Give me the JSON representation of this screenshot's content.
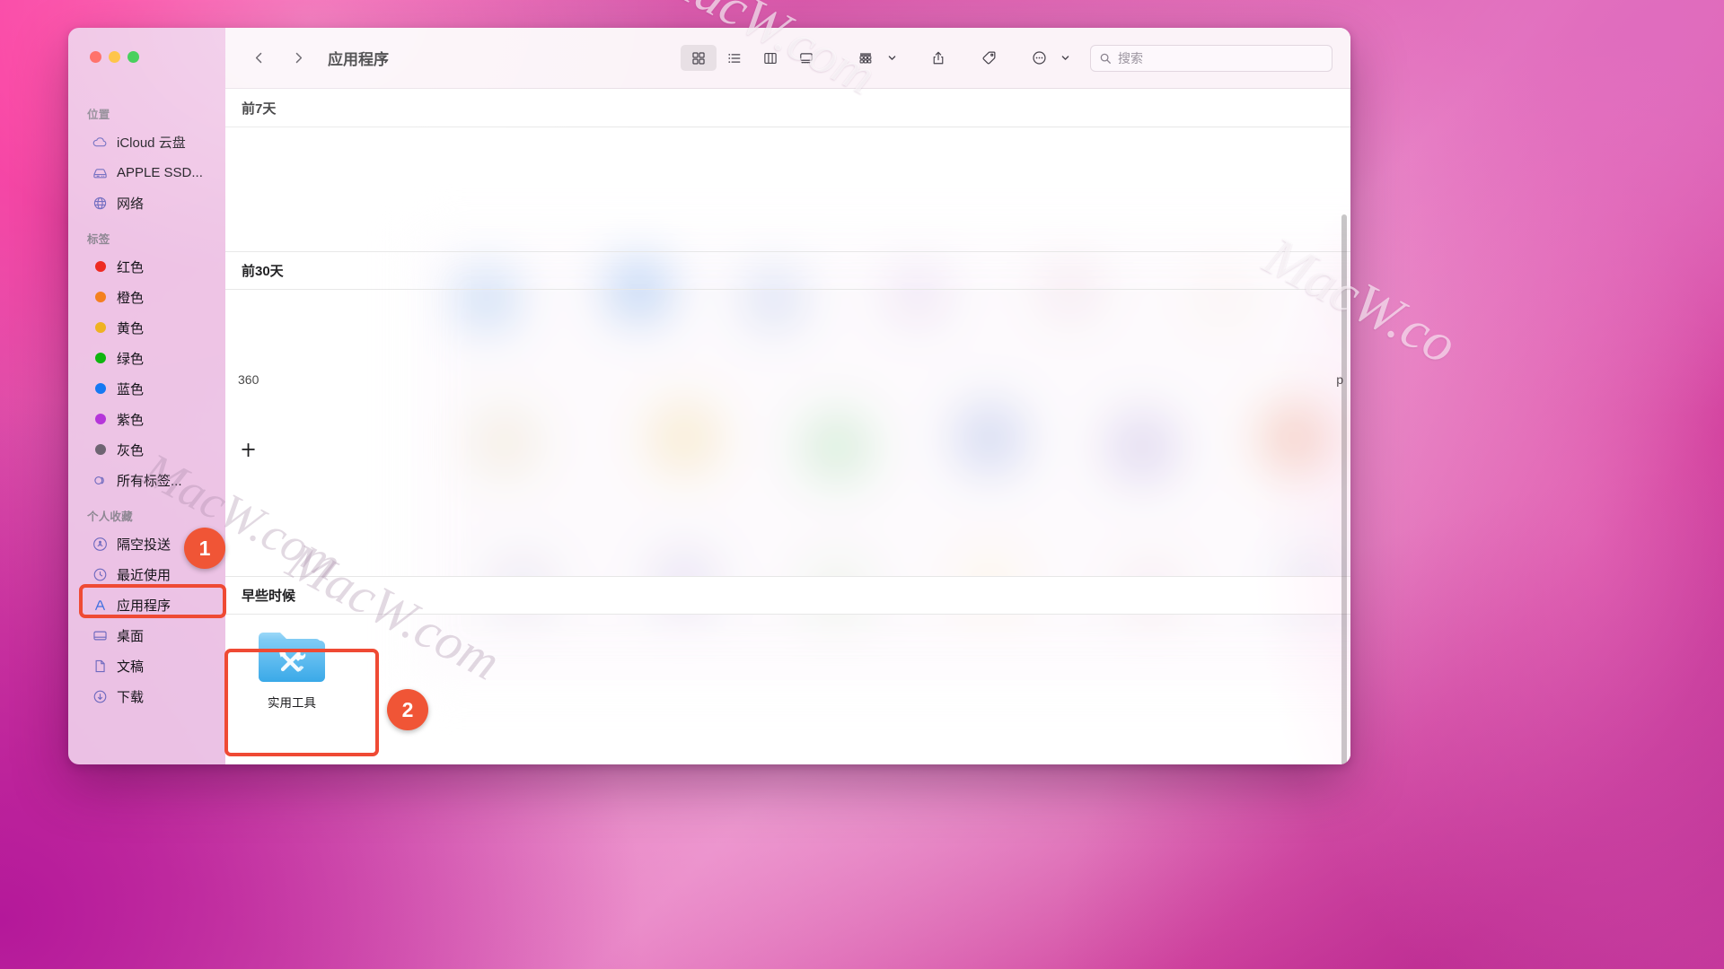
{
  "window": {
    "title": "应用程序",
    "traffic_lights": {
      "close": "#ff5f57",
      "minimize": "#febc2e",
      "maximize": "#28c840"
    }
  },
  "toolbar": {
    "back_label": "‹",
    "forward_label": "›",
    "view_buttons": [
      {
        "name": "icon-view",
        "label": "图标显示",
        "active": true
      },
      {
        "name": "list-view",
        "label": "列表显示",
        "active": false
      },
      {
        "name": "column-view",
        "label": "分栏显示",
        "active": false
      },
      {
        "name": "gallery-view",
        "label": "画廊显示",
        "active": false
      }
    ],
    "group_label": "排序方式",
    "share_label": "共享",
    "tag_label": "标签",
    "more_label": "更多"
  },
  "search": {
    "placeholder": "搜索",
    "value": ""
  },
  "sidebar": {
    "groups": [
      {
        "title": "位置",
        "items": [
          {
            "icon": "icloud-icon",
            "label": "iCloud 云盘"
          },
          {
            "icon": "harddisk-icon",
            "label": "APPLE SSD..."
          },
          {
            "icon": "globe-icon",
            "label": "网络"
          }
        ]
      },
      {
        "title": "标签",
        "items": [
          {
            "icon": "tag-dot-icon",
            "label": "红色",
            "color": "#ee2a22"
          },
          {
            "icon": "tag-dot-icon",
            "label": "橙色",
            "color": "#f4801f"
          },
          {
            "icon": "tag-dot-icon",
            "label": "黄色",
            "color": "#efb222"
          },
          {
            "icon": "tag-dot-icon",
            "label": "绿色",
            "color": "#0fb50f"
          },
          {
            "icon": "tag-dot-icon",
            "label": "蓝色",
            "color": "#1678f2"
          },
          {
            "icon": "tag-dot-icon",
            "label": "紫色",
            "color": "#b536d9"
          },
          {
            "icon": "tag-dot-icon",
            "label": "灰色",
            "color": "#6e6472"
          },
          {
            "icon": "all-tags-icon",
            "label": "所有标签..."
          }
        ]
      },
      {
        "title": "个人收藏",
        "items": [
          {
            "icon": "airdrop-icon",
            "label": "隔空投送"
          },
          {
            "icon": "clock-icon",
            "label": "最近使用"
          },
          {
            "icon": "applications-icon",
            "label": "应用程序",
            "highlighted": true
          },
          {
            "icon": "desktop-icon",
            "label": "桌面"
          },
          {
            "icon": "document-icon",
            "label": "文稿"
          },
          {
            "icon": "downloads-icon",
            "label": "下载"
          }
        ]
      }
    ]
  },
  "content": {
    "sections": [
      {
        "name": "section-last-7-days",
        "header": "前7天"
      },
      {
        "name": "section-last-30-days",
        "header": "前30天"
      },
      {
        "name": "section-plus",
        "header": "十"
      },
      {
        "name": "section-earlier",
        "header": "早些时候"
      }
    ],
    "partial_texts": {
      "count_fragment": "360",
      "name_fragment": "p"
    },
    "folders": [
      {
        "name": "utilities-folder",
        "label": "实用工具",
        "icon": "folder-tools-icon"
      }
    ]
  },
  "annotations": {
    "steps": [
      {
        "number": "1",
        "target": "sidebar-item-applications"
      },
      {
        "number": "2",
        "target": "utilities-folder"
      }
    ],
    "highlight_color": "#ef4a34"
  },
  "watermarks": [
    {
      "text": "MacW.com",
      "variant": "light"
    },
    {
      "text": "MacW.co",
      "variant": "light"
    },
    {
      "text": "MacW.com",
      "variant": "dark"
    },
    {
      "text": "MacW.com",
      "variant": "dark"
    }
  ]
}
